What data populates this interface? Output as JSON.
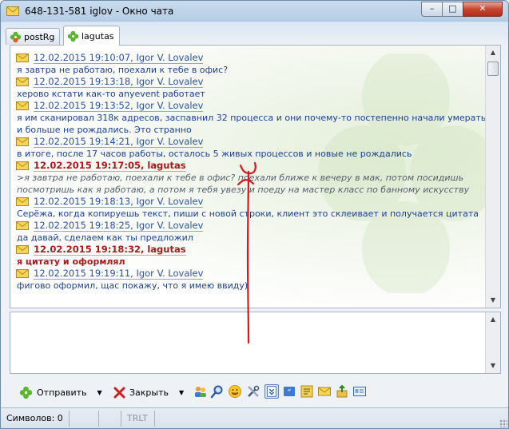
{
  "window": {
    "title": "648-131-581 iglov - Окно чата",
    "controls": {
      "minimize": "–",
      "maximize": "□",
      "close": "✕"
    }
  },
  "tabs": [
    {
      "label": "postRg",
      "active": false
    },
    {
      "label": "lagutas",
      "active": true
    }
  ],
  "messages": [
    {
      "header": "12.02.2015 19:10:07, Igor V. Lovalev",
      "own": false,
      "body": "я завтра не работаю, поехали к тебе в офис?"
    },
    {
      "header": "12.02.2015 19:13:18, Igor V. Lovalev",
      "own": false,
      "body": "херово кстати как-то anyevent работает"
    },
    {
      "header": "12.02.2015 19:13:52, Igor V. Lovalev",
      "own": false,
      "body": "я им сканировал 318к адресов, заспавнил 32 процесса и они почему-то постепенно начали умерать и больше не рождались. Это странно"
    },
    {
      "header": "12.02.2015 19:14:21, Igor V. Lovalev",
      "own": false,
      "body": "в итоге, после 17 часов работы, осталось 5 живых процессов и новые не рождались"
    },
    {
      "header": "12.02.2015 19:17:05, lagutas",
      "own": true,
      "quote": true,
      "body": ">я завтра не работаю, поехали к тебе в офис? поехали ближе к вечеру в мак, потом посидишь посмотришь как я работаю, а потом я тебя увезу и поеду на мастер класс по банному искусству"
    },
    {
      "header": "12.02.2015 19:18:13, Igor V. Lovalev",
      "own": false,
      "body": "Серёжа, когда копируешь текст, пиши с новой строки, клиент это склеивает и получается цитата"
    },
    {
      "header": "12.02.2015 19:18:25, Igor V. Lovalev",
      "own": false,
      "body": "да давай, сделаем как ты предложил"
    },
    {
      "header": "12.02.2015 19:18:32, lagutas",
      "own": true,
      "body": "я цитату и оформлял"
    },
    {
      "header": "12.02.2015 19:19:11, Igor V. Lovalev",
      "own": false,
      "body": "фигово оформил, щас покажу, что я имею ввиду)"
    }
  ],
  "input": {
    "value": "",
    "placeholder": ""
  },
  "toolbar": {
    "send_label": "Отправить",
    "close_label": "Закрыть",
    "icons": [
      "users-icon",
      "search-icon",
      "smiley-icon",
      "tools-icon",
      "scroll-down-icon",
      "quote-icon",
      "history-icon",
      "mail-icon",
      "file-transfer-icon",
      "info-card-icon"
    ]
  },
  "status": {
    "chars": "Символов: 0",
    "layout": "TRLT"
  },
  "colors": {
    "accent": "#2b52a5",
    "own": "#b01818",
    "annotation": "#e0141e"
  }
}
